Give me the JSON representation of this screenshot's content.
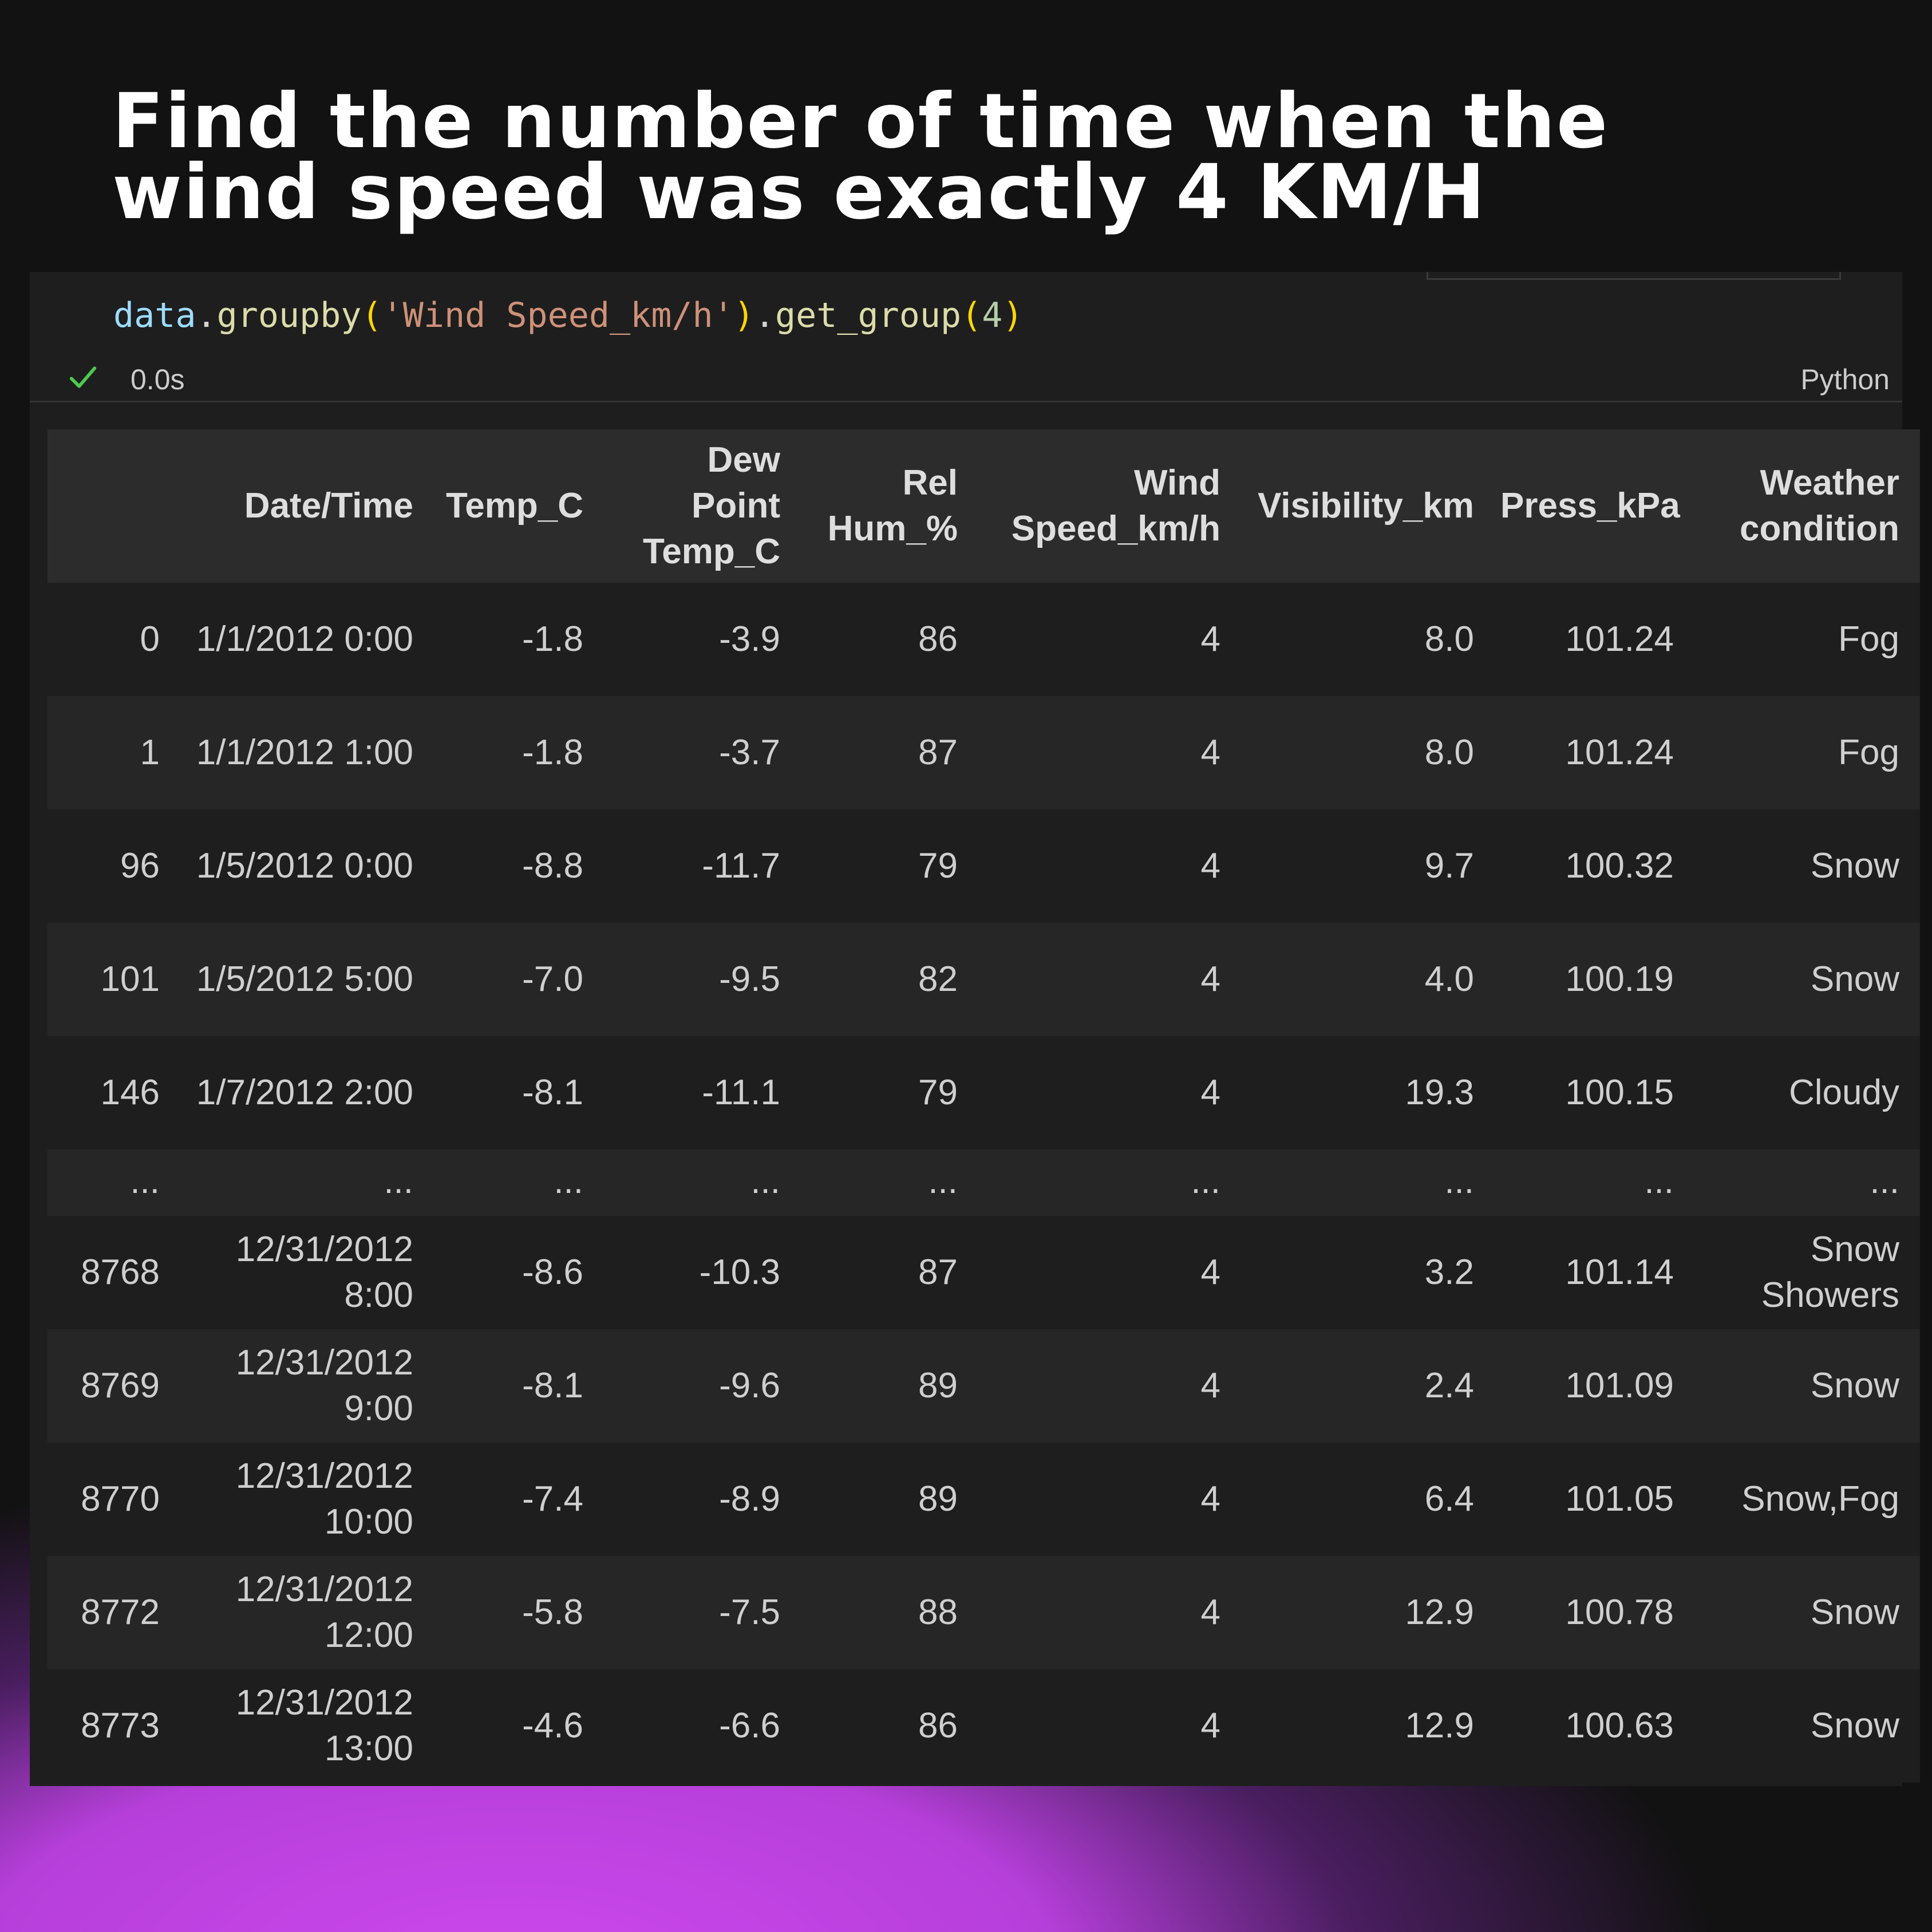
{
  "headline": "Find the number of time when the wind speed was exactly 4 KM/H",
  "code": {
    "var": "data",
    "dot1": ".",
    "method1": "groupby",
    "open1": "(",
    "arg1": "'Wind Speed_km/h'",
    "close1": ")",
    "dot2": ".",
    "method2": "get_group",
    "open2": "(",
    "arg2": "4",
    "close2": ")"
  },
  "status": {
    "duration": "0.0s",
    "language": "Python",
    "icon": "check-icon",
    "success_color": "#4ec94e"
  },
  "table": {
    "headers": [
      "",
      "Date/Time",
      "Temp_C",
      "Dew Point Temp_C",
      "Rel Hum_%",
      "Wind Speed_km/h",
      "Visibility_km",
      "Press_kPa",
      "Weather condition"
    ],
    "rows": [
      [
        "0",
        "1/1/2012 0:00",
        "-1.8",
        "-3.9",
        "86",
        "4",
        "8.0",
        "101.24",
        "Fog"
      ],
      [
        "1",
        "1/1/2012 1:00",
        "-1.8",
        "-3.7",
        "87",
        "4",
        "8.0",
        "101.24",
        "Fog"
      ],
      [
        "96",
        "1/5/2012 0:00",
        "-8.8",
        "-11.7",
        "79",
        "4",
        "9.7",
        "100.32",
        "Snow"
      ],
      [
        "101",
        "1/5/2012 5:00",
        "-7.0",
        "-9.5",
        "82",
        "4",
        "4.0",
        "100.19",
        "Snow"
      ],
      [
        "146",
        "1/7/2012 2:00",
        "-8.1",
        "-11.1",
        "79",
        "4",
        "19.3",
        "100.15",
        "Cloudy"
      ],
      [
        "...",
        "...",
        "...",
        "...",
        "...",
        "...",
        "...",
        "...",
        "..."
      ],
      [
        "8768",
        "12/31/2012 8:00",
        "-8.6",
        "-10.3",
        "87",
        "4",
        "3.2",
        "101.14",
        "Snow Showers"
      ],
      [
        "8769",
        "12/31/2012 9:00",
        "-8.1",
        "-9.6",
        "89",
        "4",
        "2.4",
        "101.09",
        "Snow"
      ],
      [
        "8770",
        "12/31/2012 10:00",
        "-7.4",
        "-8.9",
        "89",
        "4",
        "6.4",
        "101.05",
        "Snow,Fog"
      ],
      [
        "8772",
        "12/31/2012 12:00",
        "-5.8",
        "-7.5",
        "88",
        "4",
        "12.9",
        "100.78",
        "Snow"
      ],
      [
        "8773",
        "12/31/2012 13:00",
        "-4.6",
        "-6.6",
        "86",
        "4",
        "12.9",
        "100.63",
        "Snow"
      ]
    ]
  },
  "colors": {
    "background": "#121212",
    "panel": "#1e1e1e",
    "accent_glow": "#cc48ec"
  }
}
